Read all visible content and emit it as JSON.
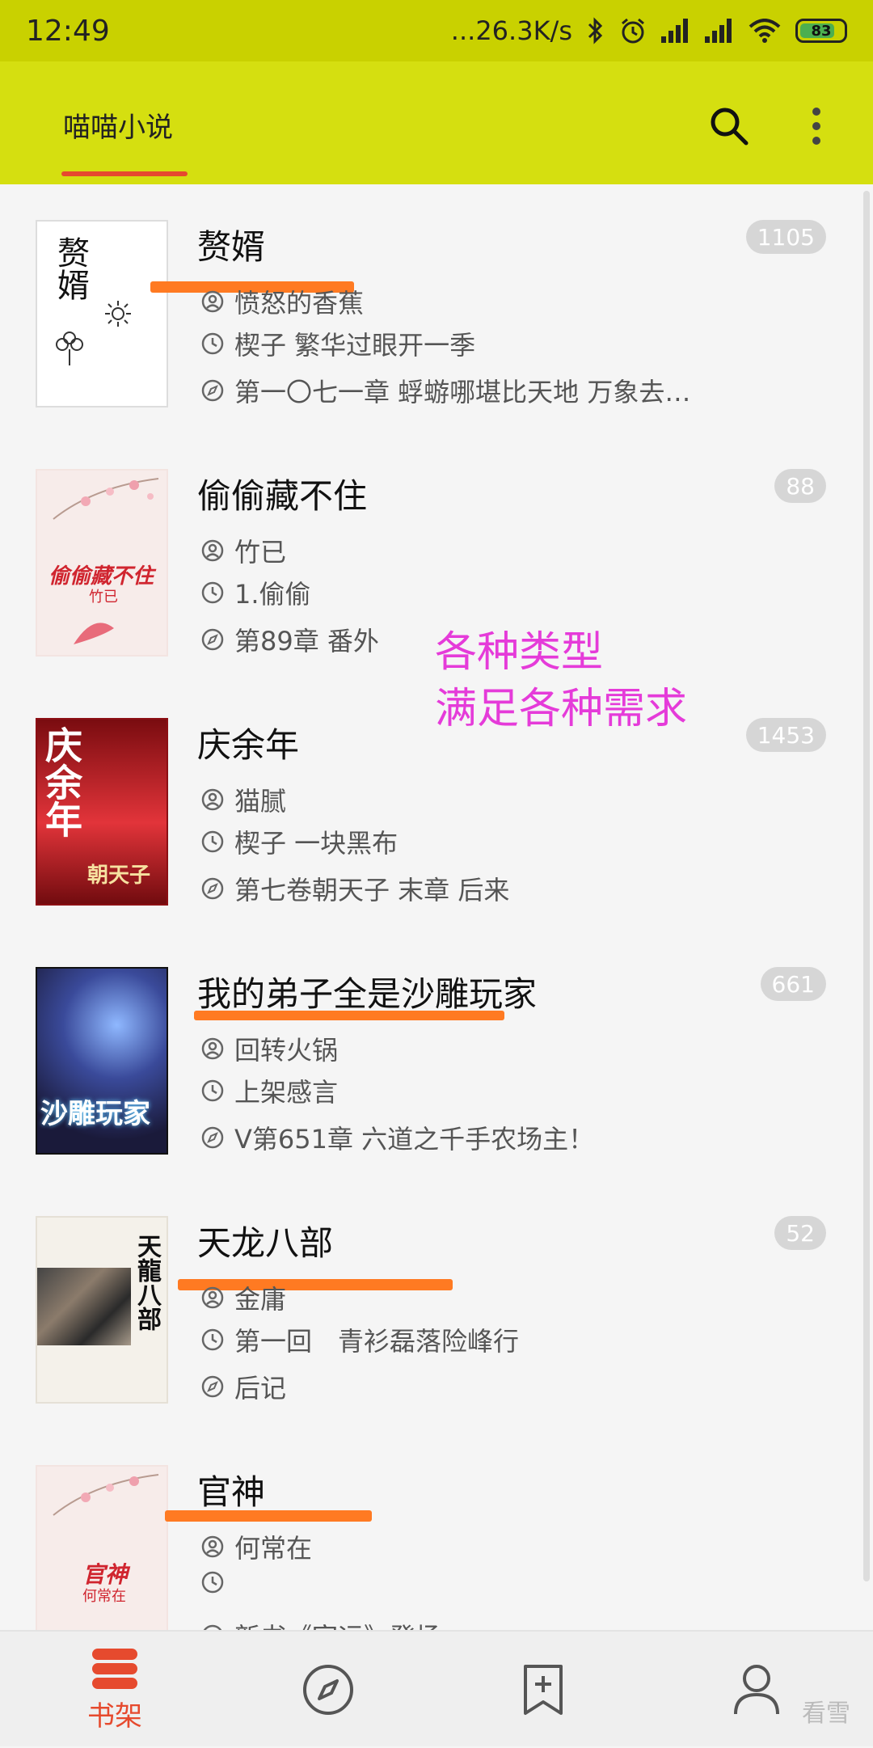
{
  "status_bar": {
    "time": "12:49",
    "network_speed": "...26.3K/s",
    "battery": "83",
    "battery_level_pct": 83
  },
  "app_bar": {
    "title": "喵喵小说"
  },
  "books": [
    {
      "title": "赘婿",
      "author": "愤怒的香蕉",
      "update": "楔子 繁华过眼开一季",
      "latest": "第一〇七一章 蜉蝣哪堪比天地 万象去…",
      "count": "1105",
      "cover_text": "赘婿"
    },
    {
      "title": "偷偷藏不住",
      "author": "竹已",
      "update": "1.偷偷",
      "latest": "第89章 番外",
      "count": "88",
      "cover_text": "偷偷藏不住",
      "cover_author": "竹已"
    },
    {
      "title": "庆余年",
      "author": "猫腻",
      "update": "楔子 一块黑布",
      "latest": "第七卷朝天子 末章 后来",
      "count": "1453",
      "cover_text": "庆余年",
      "cover_sub": "朝天子"
    },
    {
      "title": "我的弟子全是沙雕玩家",
      "author": "回转火锅",
      "update": "上架感言",
      "latest": "V第651章 六道之千手农场主！",
      "count": "661",
      "cover_text": "沙雕玩家"
    },
    {
      "title": "天龙八部",
      "author": "金庸",
      "update": "第一回　青衫磊落险峰行",
      "latest": "后记",
      "count": "52",
      "cover_text": "天龍八部"
    },
    {
      "title": "官神",
      "author": "何常在",
      "update": "",
      "latest": "新书《宦运》登场",
      "count": "",
      "cover_text": "官神",
      "cover_author": "何常在"
    }
  ],
  "promo": {
    "line1": "各种类型",
    "line2": "满足各种需求"
  },
  "bottom_nav": {
    "items": [
      {
        "label": "书架",
        "icon": "bookshelf-icon",
        "active": true
      },
      {
        "label": "",
        "icon": "compass-icon",
        "active": false
      },
      {
        "label": "",
        "icon": "bookmark-add-icon",
        "active": false
      },
      {
        "label": "",
        "icon": "user-icon",
        "active": false
      }
    ]
  },
  "watermark": "看雪",
  "colors": {
    "status_bar": "#c9d100",
    "app_bar": "#d5df10",
    "accent": "#e64a2e",
    "promo_text": "#e53bd9",
    "highlight_mark": "#ff7a22"
  }
}
